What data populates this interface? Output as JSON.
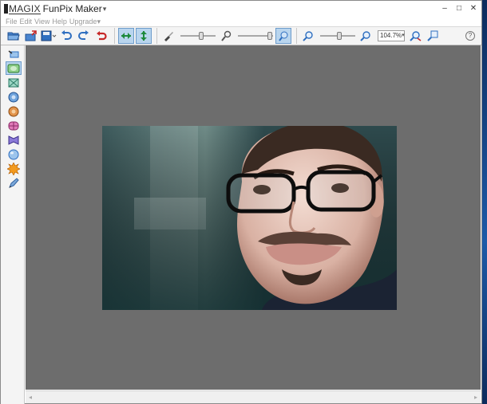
{
  "title": {
    "brand": "MAGIX",
    "app_name": "FunPix Maker",
    "arrow": "▾"
  },
  "window_controls": {
    "minimize": "–",
    "maximize": "□",
    "close": "✕"
  },
  "menu": [
    "File",
    "Edit",
    "View",
    "Help",
    "Upgrade",
    "▾"
  ],
  "toolbar": {
    "zoom_value": "104.7%",
    "zoom_caret": "▾",
    "help": "?"
  },
  "toolbar_icons": [
    "open-folder-icon",
    "import-icon",
    "save-icon",
    "undo-icon",
    "redo-icon",
    "reset-icon",
    "horizontal-arrows-icon",
    "vertical-arrows-icon",
    "brush-icon",
    "small-brush-icon",
    "brush-size-icon",
    "zoom-out-icon",
    "zoom-in-icon",
    "zoom-fit-icon",
    "zoom-actual-icon"
  ],
  "sidebar_tools": [
    "warp-tool-icon",
    "frame-tool-icon",
    "shrink-tool-icon",
    "bulge-tool-icon",
    "pinch-tool-icon",
    "barrel-tool-icon",
    "squeeze-tool-icon",
    "sphere-tool-icon",
    "explode-tool-icon",
    "pen-tool-icon"
  ],
  "colors": {
    "accent": "#b9d5ee",
    "canvas": "#6d6d6d",
    "icon_blue": "#2f6fc0",
    "icon_red": "#c62828"
  },
  "sliders": {
    "brush_size": 0.6,
    "brush_strength": 0.9,
    "zoom": 0.55
  }
}
